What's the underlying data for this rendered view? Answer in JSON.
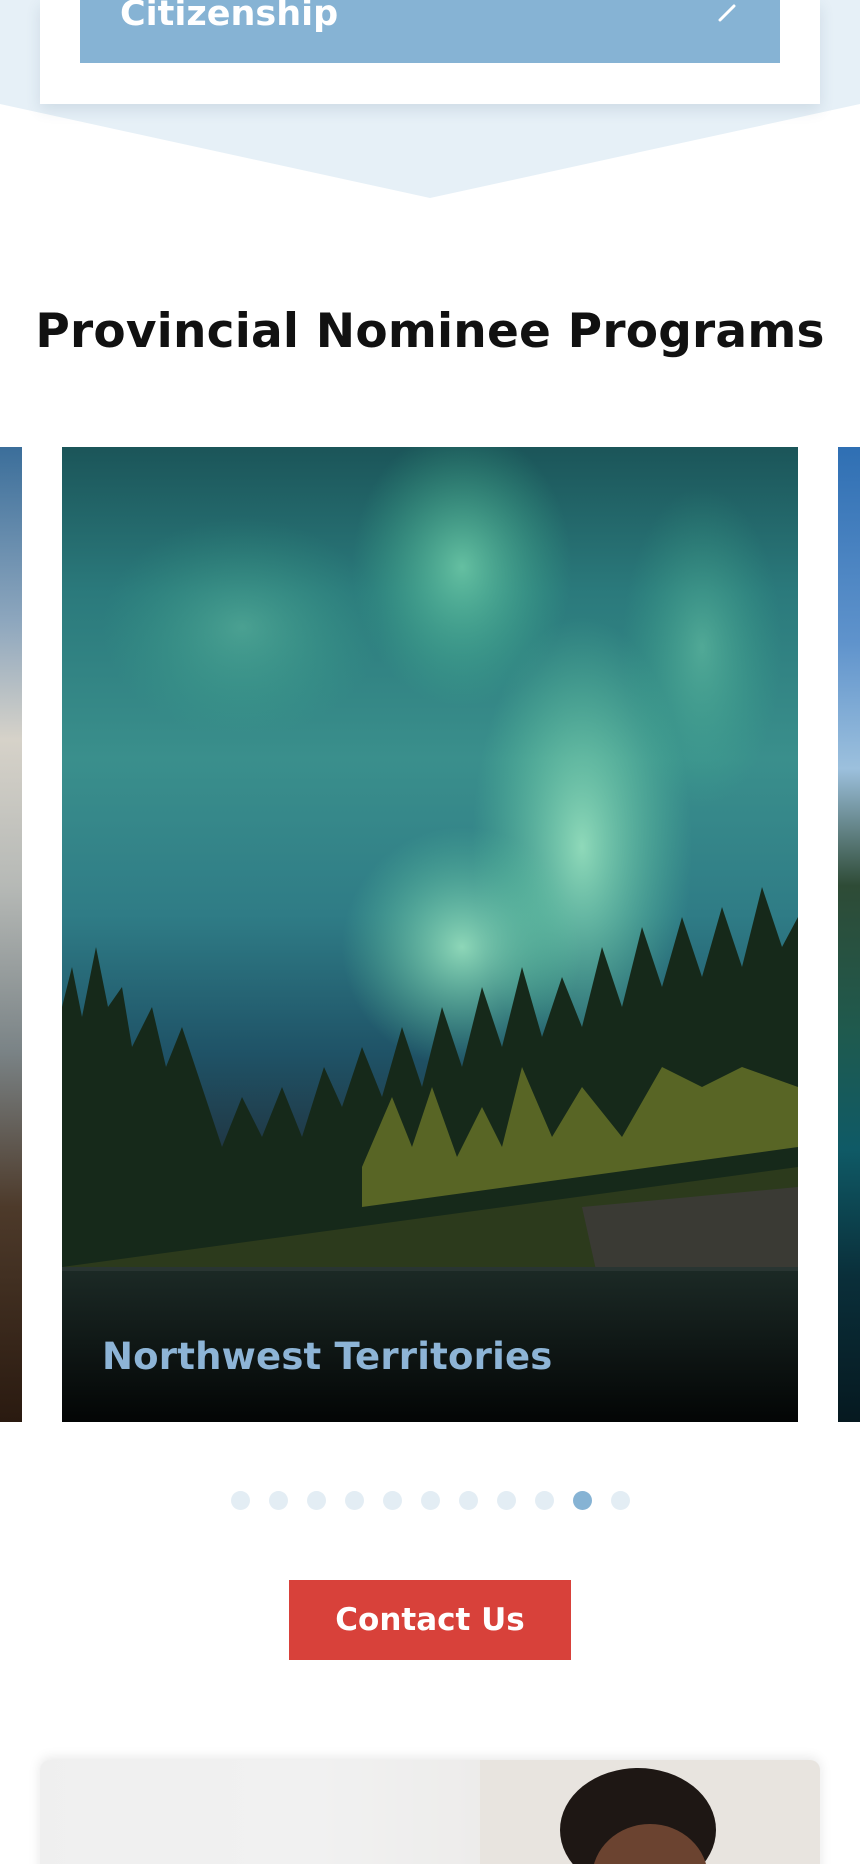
{
  "top_card": {
    "button_label": "Citizenship",
    "button_icon": "chevron-right-icon"
  },
  "section": {
    "title": "Provincial Nominee Programs"
  },
  "carousel": {
    "current_slide_caption": "Northwest Territories",
    "slide_count": 11,
    "active_index": 9
  },
  "cta": {
    "contact_label": "Contact Us"
  },
  "colors": {
    "accent_blue": "#86b3d4",
    "band_bg": "#e6f0f7",
    "cta_red": "#d8413a",
    "dot_inactive": "#e3edf4"
  }
}
